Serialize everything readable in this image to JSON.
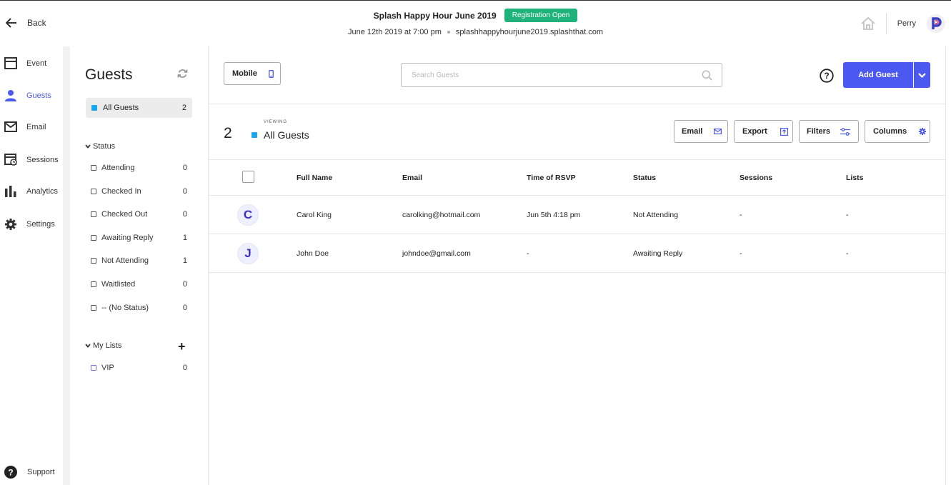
{
  "topbar": {
    "back_label": "Back",
    "event_title": "Splash Happy Hour June 2019",
    "registration_badge": "Registration Open",
    "event_date": "June 12th 2019 at 7:00 pm",
    "event_url": "splashhappyhourjune2019.splashthat.com",
    "username": "Perry"
  },
  "nav": {
    "items": [
      {
        "label": "Event",
        "icon": "calendar-icon"
      },
      {
        "label": "Guests",
        "icon": "person-icon",
        "active": true
      },
      {
        "label": "Email",
        "icon": "envelope-icon"
      },
      {
        "label": "Sessions",
        "icon": "sessions-icon"
      },
      {
        "label": "Analytics",
        "icon": "bar-chart-icon"
      },
      {
        "label": "Settings",
        "icon": "gear-icon"
      }
    ],
    "support_label": "Support"
  },
  "sidebar": {
    "title": "Guests",
    "all_guests": {
      "label": "All Guests",
      "count": "2"
    },
    "status_header": "Status",
    "statuses": [
      {
        "label": "Attending",
        "count": "0"
      },
      {
        "label": "Checked In",
        "count": "0"
      },
      {
        "label": "Checked Out",
        "count": "0"
      },
      {
        "label": "Awaiting Reply",
        "count": "1"
      },
      {
        "label": "Not Attending",
        "count": "1"
      },
      {
        "label": "Waitlisted",
        "count": "0"
      },
      {
        "label": "-- (No Status)",
        "count": "0"
      }
    ],
    "lists_header": "My Lists",
    "add_list_label": "+",
    "lists": [
      {
        "label": "VIP",
        "count": "0"
      }
    ]
  },
  "toolbar": {
    "mobile_label": "Mobile",
    "search_placeholder": "Search Guests",
    "add_guest_label": "Add Guest"
  },
  "viewing": {
    "count": "2",
    "label": "VIEWING",
    "value": "All Guests"
  },
  "actions": {
    "email": "Email",
    "export": "Export",
    "filters": "Filters",
    "columns": "Columns"
  },
  "table": {
    "columns": [
      "Full Name",
      "Email",
      "Time of RSVP",
      "Status",
      "Sessions",
      "Lists"
    ],
    "rows": [
      {
        "avatar": "C",
        "name": "Carol King",
        "email": "carolking@hotmail.com",
        "rsvp": "Jun 5th 4:18 pm",
        "status": "Not Attending",
        "sessions": "-",
        "lists": "-"
      },
      {
        "avatar": "J",
        "name": "John Doe",
        "email": "johndoe@gmail.com",
        "rsvp": "-",
        "status": "Awaiting Reply",
        "sessions": "-",
        "lists": "-"
      }
    ]
  },
  "colors": {
    "accent": "#4b59f0",
    "badge_green": "#1fb27a",
    "all_guests_square": "#1aa7ec"
  }
}
